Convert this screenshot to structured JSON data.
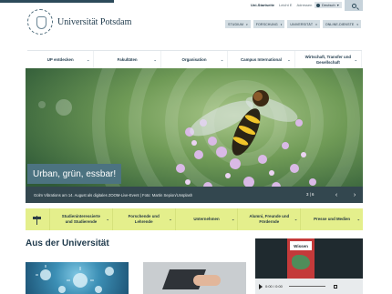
{
  "header": {
    "university_name": "Universität Potsdam",
    "util_links": [
      "Uni-Startseite",
      "Leicht E",
      "Adressen"
    ],
    "language": "Deutsch",
    "subnav": [
      {
        "label": "STUDIUM"
      },
      {
        "label": "FORSCHUNG"
      },
      {
        "label": "UNIVERSITÄT"
      },
      {
        "label": "ONLINE-DIENSTE"
      }
    ]
  },
  "mainnav": {
    "items": [
      {
        "label": "UP entdecken"
      },
      {
        "label": "Fakultäten"
      },
      {
        "label": "Organisation"
      },
      {
        "label": "Campus International"
      },
      {
        "label": "Wirtschaft, Transfer und Gesellschaft"
      }
    ]
  },
  "hero": {
    "title": "Urban, grün, essbar!",
    "caption": "Golm Vibrations am 14. August als digitales ZOOM-Live-Event | Foto: Martin Sepion/Unsplash",
    "counter": "3 | 6",
    "prev_icon": "chevron-left",
    "next_icon": "chevron-right"
  },
  "target_groups": {
    "icon": "signpost-icon",
    "items": [
      {
        "label": "Studieninteressierte und Studierende"
      },
      {
        "label": "Forschende und Lehrende"
      },
      {
        "label": "Unternehmen"
      },
      {
        "label": "Alumni, Freunde und Fördernde"
      },
      {
        "label": "Presse und Medien"
      }
    ]
  },
  "news": {
    "heading": "Aus der Universität"
  },
  "video": {
    "poster_label": "Wissen",
    "time": "0:00 / 0:00"
  },
  "colors": {
    "accent_dark": "#2c4a5a",
    "target_nav_bg": "#e4ef8c",
    "caption_bg": "#33474f",
    "hero_title_bg": "#4c7381"
  }
}
